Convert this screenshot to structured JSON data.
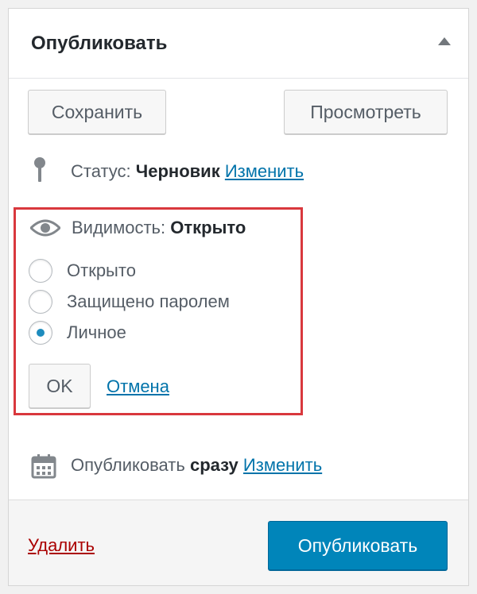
{
  "header": {
    "title": "Опубликовать"
  },
  "actions": {
    "save_label": "Сохранить",
    "preview_label": "Просмотреть"
  },
  "status": {
    "label": "Статус:",
    "value": "Черновик",
    "edit_link": "Изменить"
  },
  "visibility": {
    "label": "Видимость:",
    "value": "Открыто",
    "options": [
      {
        "label": "Открыто",
        "selected": false
      },
      {
        "label": "Защищено паролем",
        "selected": false
      },
      {
        "label": "Личное",
        "selected": true
      }
    ],
    "ok_label": "OK",
    "cancel_link": "Отмена"
  },
  "schedule": {
    "label": "Опубликовать",
    "value": "сразу",
    "edit_link": "Изменить"
  },
  "footer": {
    "delete_link": "Удалить",
    "publish_label": "Опубликовать"
  },
  "colors": {
    "primary": "#0085ba",
    "link": "#0073aa",
    "delete": "#aa0000",
    "highlight_border": "#d9383d",
    "radio_checked": "#1e8cbe"
  }
}
